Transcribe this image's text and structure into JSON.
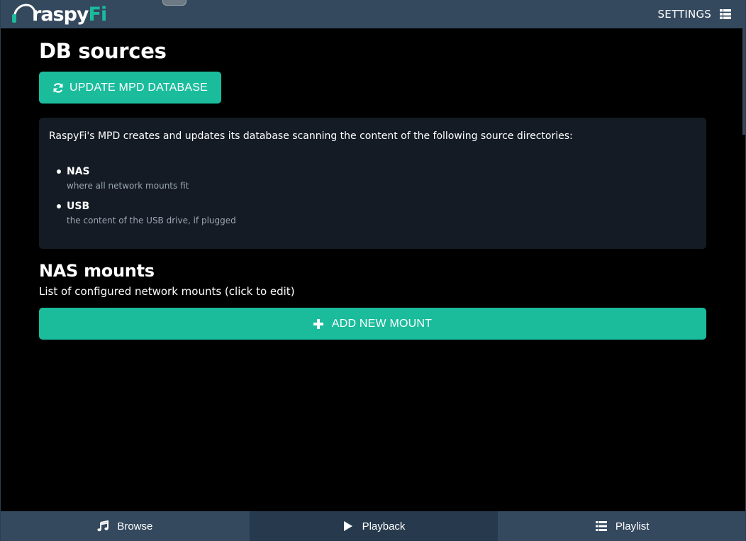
{
  "header": {
    "logo_text": "raspy",
    "logo_accent": "Fi",
    "settings_label": "SETTINGS"
  },
  "sections": {
    "db_sources": {
      "title": "DB sources",
      "update_button_label": "UPDATE MPD DATABASE",
      "description": "RaspyFi's MPD creates and updates its database scanning the content of the following source directories:",
      "sources": [
        {
          "name": "NAS",
          "description": "where all network mounts fit"
        },
        {
          "name": "USB",
          "description": "the content of the USB drive, if plugged"
        }
      ]
    },
    "nas_mounts": {
      "title": "NAS mounts",
      "subtitle": "List of configured network mounts (click to edit)",
      "add_button_label": "ADD NEW MOUNT"
    }
  },
  "bottom_nav": {
    "tabs": [
      {
        "label": "Browse",
        "icon": "music-note-icon",
        "active": false
      },
      {
        "label": "Playback",
        "icon": "play-icon",
        "active": true
      },
      {
        "label": "Playlist",
        "icon": "list-icon",
        "active": false
      }
    ]
  },
  "colors": {
    "accent": "#1abc9c",
    "header_bg": "#34495e",
    "content_bg": "#000000",
    "panel_bg": "#141b24"
  }
}
